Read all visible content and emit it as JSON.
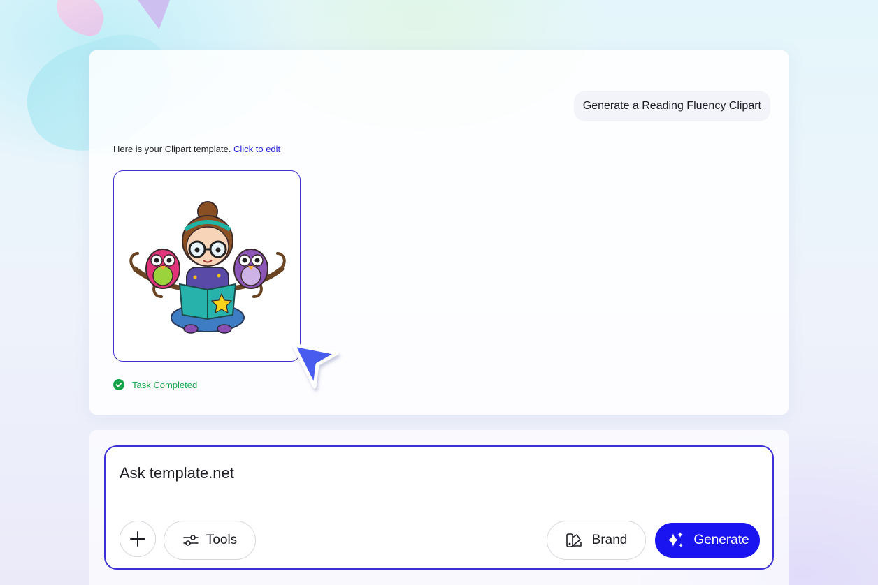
{
  "chat": {
    "user_message": "Generate a Reading Fluency Clipart",
    "reply_text": "Here is your Clipart template.",
    "reply_link": "Click to edit",
    "status_text": "Task Completed"
  },
  "input": {
    "placeholder": "Ask template.net",
    "tools_label": "Tools",
    "brand_label": "Brand",
    "generate_label": "Generate"
  },
  "icons": {
    "status": "check-circle-icon",
    "add": "plus-icon",
    "tools": "sliders-icon",
    "brand": "brand-palette-icon",
    "generate": "sparkle-icon",
    "cursor": "cursor-arrow-icon"
  },
  "colors": {
    "accent": "#1a14f0",
    "border_accent": "#3b2fd8",
    "link": "#2a25d9",
    "success": "#16a34a"
  }
}
